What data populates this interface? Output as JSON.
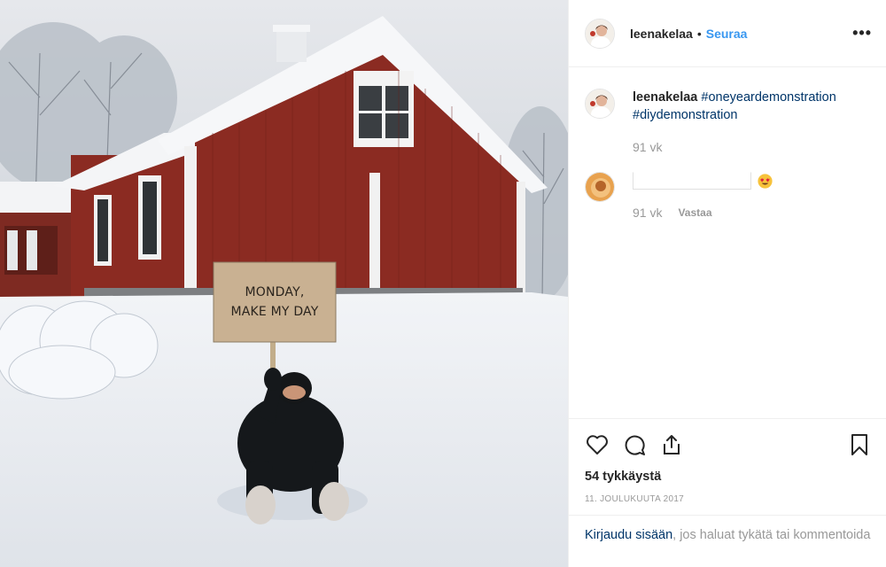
{
  "post": {
    "photo_sign_text": [
      "MONDAY,",
      "MAKE MY DAY"
    ],
    "header": {
      "username": "leenakelaa",
      "separator": "•",
      "follow_label": "Seuraa",
      "more_label": "•••"
    },
    "caption": {
      "username": "leenakelaa",
      "hashtags": [
        "#oneyeardemonstration",
        "#diydemonstration"
      ],
      "age": "91 vk"
    },
    "comment": {
      "age": "91 vk",
      "reply_label": "Vastaa",
      "emoji": "heart-eyes-emoji"
    },
    "actions": {
      "icons": [
        "heart-icon",
        "comment-icon",
        "share-icon",
        "bookmark-icon"
      ]
    },
    "likes": "54 tykkäystä",
    "date": "11. joulukuuta 2017",
    "login_prompt": {
      "link": "Kirjaudu sisään",
      "rest": ", jos haluat tykätä tai kommentoida"
    },
    "colors": {
      "accent_blue": "#3897f0",
      "hashtag_blue": "#003569",
      "muted_gray": "#999999",
      "barn_red": "#8b2b22"
    }
  }
}
